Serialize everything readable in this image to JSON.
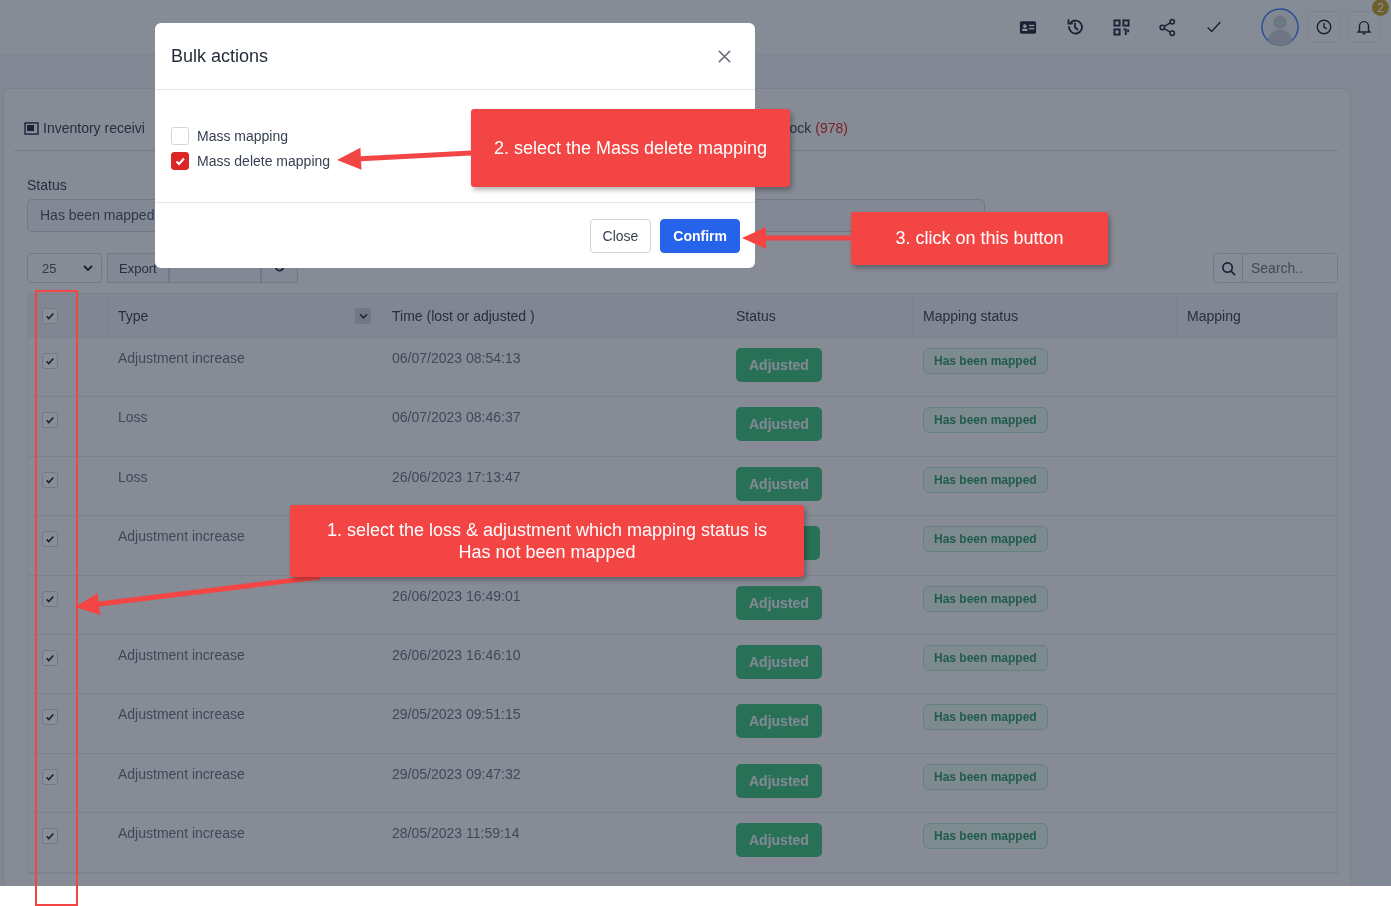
{
  "header": {
    "notification_count": "2"
  },
  "tabs": [
    {
      "label": "Inventory receivi"
    },
    {
      "label": "ock",
      "count": "(978)"
    }
  ],
  "filter": {
    "label": "Status",
    "value": "Has been mapped"
  },
  "toolbar": {
    "page_size": "25",
    "buttons": [
      "Export"
    ],
    "search_placeholder": "Search.."
  },
  "table": {
    "all_checked": true,
    "columns": [
      "Type",
      "Time (lost or adjusted )",
      "Status",
      "Mapping status",
      "Mapping"
    ],
    "rows": [
      {
        "checked": true,
        "type": "Adjustment increase",
        "time": "06/07/2023 08:54:13",
        "status": "Adjusted",
        "mapping_status": "Has been mapped"
      },
      {
        "checked": true,
        "type": "Loss",
        "time": "06/07/2023 08:46:37",
        "status": "Adjusted",
        "mapping_status": "Has been mapped"
      },
      {
        "checked": true,
        "type": "Loss",
        "time": "26/06/2023 17:13:47",
        "status": "Adjusted",
        "mapping_status": "Has been mapped"
      },
      {
        "checked": true,
        "type": "Adjustment increase",
        "mapping_status": "Has been mapped"
      },
      {
        "checked": true,
        "time": "26/06/2023 16:49:01",
        "status": "Adjusted",
        "mapping_status": "Has been mapped"
      },
      {
        "checked": true,
        "type": "Adjustment increase",
        "time": "26/06/2023 16:46:10",
        "status": "Adjusted",
        "mapping_status": "Has been mapped"
      },
      {
        "checked": true,
        "type": "Adjustment increase",
        "time": "29/05/2023 09:51:15",
        "status": "Adjusted",
        "mapping_status": "Has been mapped"
      },
      {
        "checked": true,
        "type": "Adjustment increase",
        "time": "29/05/2023 09:47:32",
        "status": "Adjusted",
        "mapping_status": "Has been mapped"
      },
      {
        "checked": true,
        "type": "Adjustment increase",
        "time": "28/05/2023 11:59:14",
        "status": "Adjusted",
        "mapping_status": "Has been mapped"
      }
    ]
  },
  "modal": {
    "title": "Bulk actions",
    "options": [
      {
        "label": "Mass mapping",
        "checked": false
      },
      {
        "label": "Mass delete mapping",
        "checked": true
      }
    ],
    "buttons": [
      {
        "label": "Close",
        "kind": "secondary"
      },
      {
        "label": "Confirm",
        "kind": "primary"
      }
    ]
  },
  "annotations": [
    {
      "text": "2. select the Mass delete mapping"
    },
    {
      "text": "3. click on this button"
    },
    {
      "text": "1. select the loss & adjustment which mapping status is Has not been mapped"
    }
  ]
}
